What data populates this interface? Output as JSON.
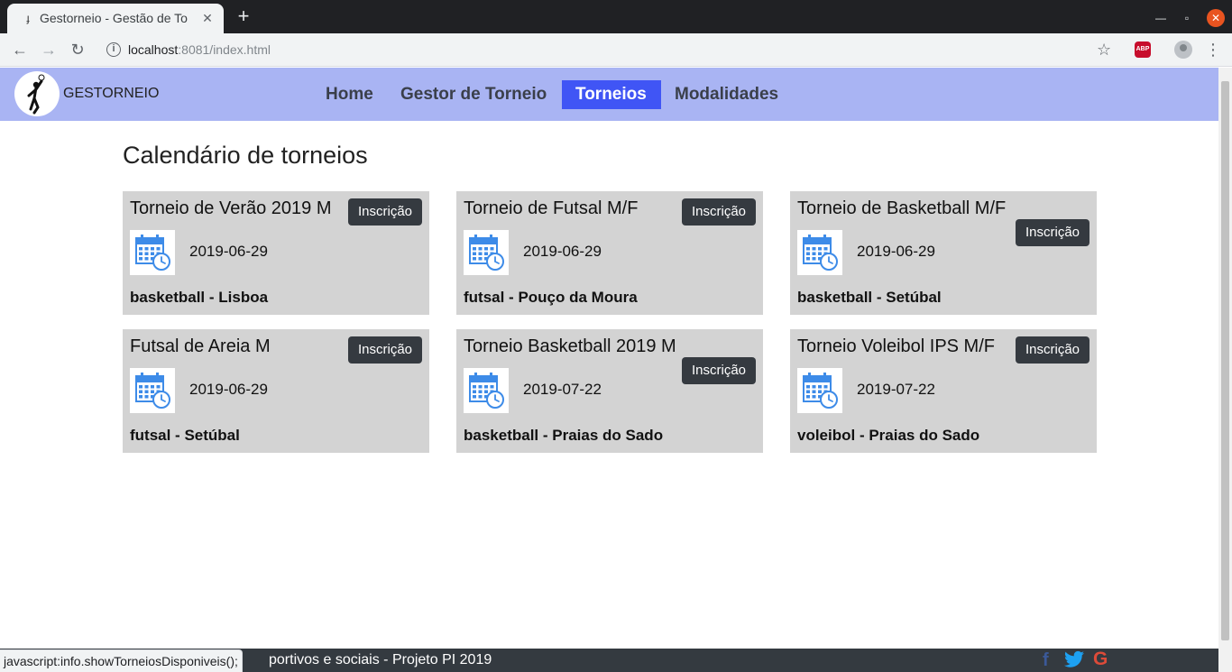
{
  "browser": {
    "tab_title": "Gestorneio - Gestão de To",
    "url_host": "localhost",
    "url_rest": ":8081/index.html"
  },
  "site": {
    "brand": "GESTORNEIO",
    "nav": [
      {
        "label": "Home"
      },
      {
        "label": "Gestor de Torneio"
      },
      {
        "label": "Torneios"
      },
      {
        "label": "Modalidades"
      }
    ],
    "active_nav": "Torneios",
    "accent_color": "#4055f5",
    "nav_bg_color": "#a9b4f3"
  },
  "main": {
    "title": "Calendário de torneios",
    "cards": [
      {
        "title": "Torneio de Verão 2019 M",
        "date": "2019-06-29",
        "footer": "basketball - Lisboa",
        "button": "Inscrição"
      },
      {
        "title": "Torneio de Futsal M/F",
        "date": "2019-06-29",
        "footer": "futsal - Pouço da Moura",
        "button": "Inscrição"
      },
      {
        "title": "Torneio de Basketball M/F",
        "date": "2019-06-29",
        "footer": "basketball - Setúbal",
        "button": "Inscrição"
      },
      {
        "title": "Futsal de Areia M",
        "date": "2019-06-29",
        "footer": "futsal - Setúbal",
        "button": "Inscrição"
      },
      {
        "title": "Torneio Basketball 2019 M",
        "date": "2019-07-22",
        "footer": "basketball - Praias do Sado",
        "button": "Inscrição"
      },
      {
        "title": "Torneio Voleibol IPS M/F",
        "date": "2019-07-22",
        "footer": "voleibol - Praias do Sado",
        "button": "Inscrição"
      }
    ]
  },
  "footer": {
    "text": "portivos e sociais - Projeto PI 2019",
    "icons": [
      "facebook-icon",
      "twitter-icon",
      "google-icon"
    ]
  },
  "status_bar": {
    "text": "javascript:info.showTorneiosDisponiveis();"
  }
}
